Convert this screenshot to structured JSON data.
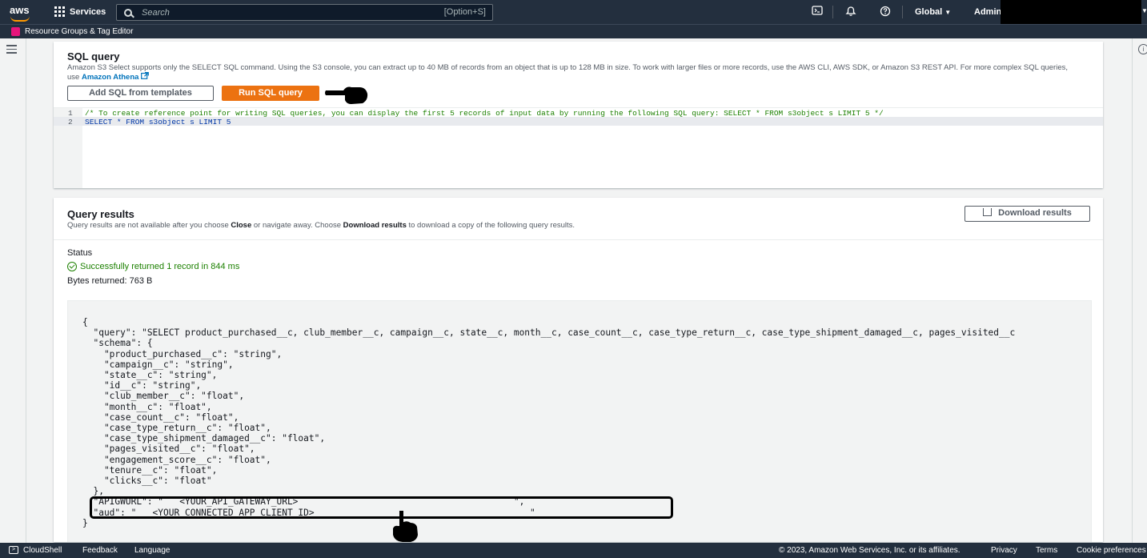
{
  "topnav": {
    "logo": "aws",
    "services_label": "Services",
    "search_placeholder": "Search",
    "search_shortcut": "[Option+S]",
    "region": "Global",
    "account": "Admin/"
  },
  "subnav": {
    "label": "Resource Groups & Tag Editor"
  },
  "sql_panel": {
    "title": "SQL query",
    "description": "Amazon S3 Select supports only the SELECT SQL command. Using the S3 console, you can extract up to 40 MB of records from an object that is up to 128 MB in size. To work with larger files or more records, use the AWS CLI, AWS SDK, or Amazon S3 REST API. For more complex SQL queries, use",
    "athena_link": "Amazon Athena",
    "add_templates_button": "Add SQL from templates",
    "run_button": "Run SQL query",
    "editor_lines": [
      {
        "number": "1",
        "text": "/* To create reference point for writing SQL queries, you can display the first 5 records of input data by running the following SQL query: SELECT * FROM s3object s LIMIT 5 */"
      },
      {
        "number": "2",
        "text": "SELECT * FROM s3object s LIMIT 5"
      }
    ]
  },
  "results_panel": {
    "title": "Query results",
    "description_pre": "Query results are not available after you choose ",
    "description_close": "Close",
    "description_mid": " or navigate away. Choose ",
    "description_download": "Download results",
    "description_post": " to download a copy of the following query results.",
    "download_button": "Download results",
    "status_label": "Status",
    "status_text": "Successfully returned 1 record in 844 ms",
    "bytes_text": "Bytes returned: 763 B",
    "json_lines": [
      "{",
      "  \"query\": \"SELECT product_purchased__c, club_member__c, campaign__c, state__c, month__c, case_count__c, case_type_return__c, case_type_shipment_damaged__c, pages_visited__c",
      "  \"schema\": {",
      "    \"product_purchased__c\": \"string\",",
      "    \"campaign__c\": \"string\",",
      "    \"state__c\": \"string\",",
      "    \"id__c\": \"string\",",
      "    \"club_member__c\": \"float\",",
      "    \"month__c\": \"float\",",
      "    \"case_count__c\": \"float\",",
      "    \"case_type_return__c\": \"float\",",
      "    \"case_type_shipment_damaged__c\": \"float\",",
      "    \"pages_visited__c\": \"float\",",
      "    \"engagement_score__c\": \"float\",",
      "    \"tenure__c\": \"float\",",
      "    \"clicks__c\": \"float\"",
      "  },",
      "  \"APIGWURL\": \"   <YOUR_API_GATEWAY_URL>                                        \",",
      "  \"aud\": \"   <YOUR_CONNECTED_APP_CLIENT_ID>                                        \"",
      "}"
    ]
  },
  "footer": {
    "cloudshell": "CloudShell",
    "feedback": "Feedback",
    "language": "Language",
    "copyright": "© 2023, Amazon Web Services, Inc. or its affiliates.",
    "privacy": "Privacy",
    "terms": "Terms",
    "cookies": "Cookie preferences"
  },
  "colors": {
    "nav_bg": "#232f3e",
    "primary_button": "#ec7211",
    "success": "#1d8102",
    "link": "#0073bb"
  }
}
